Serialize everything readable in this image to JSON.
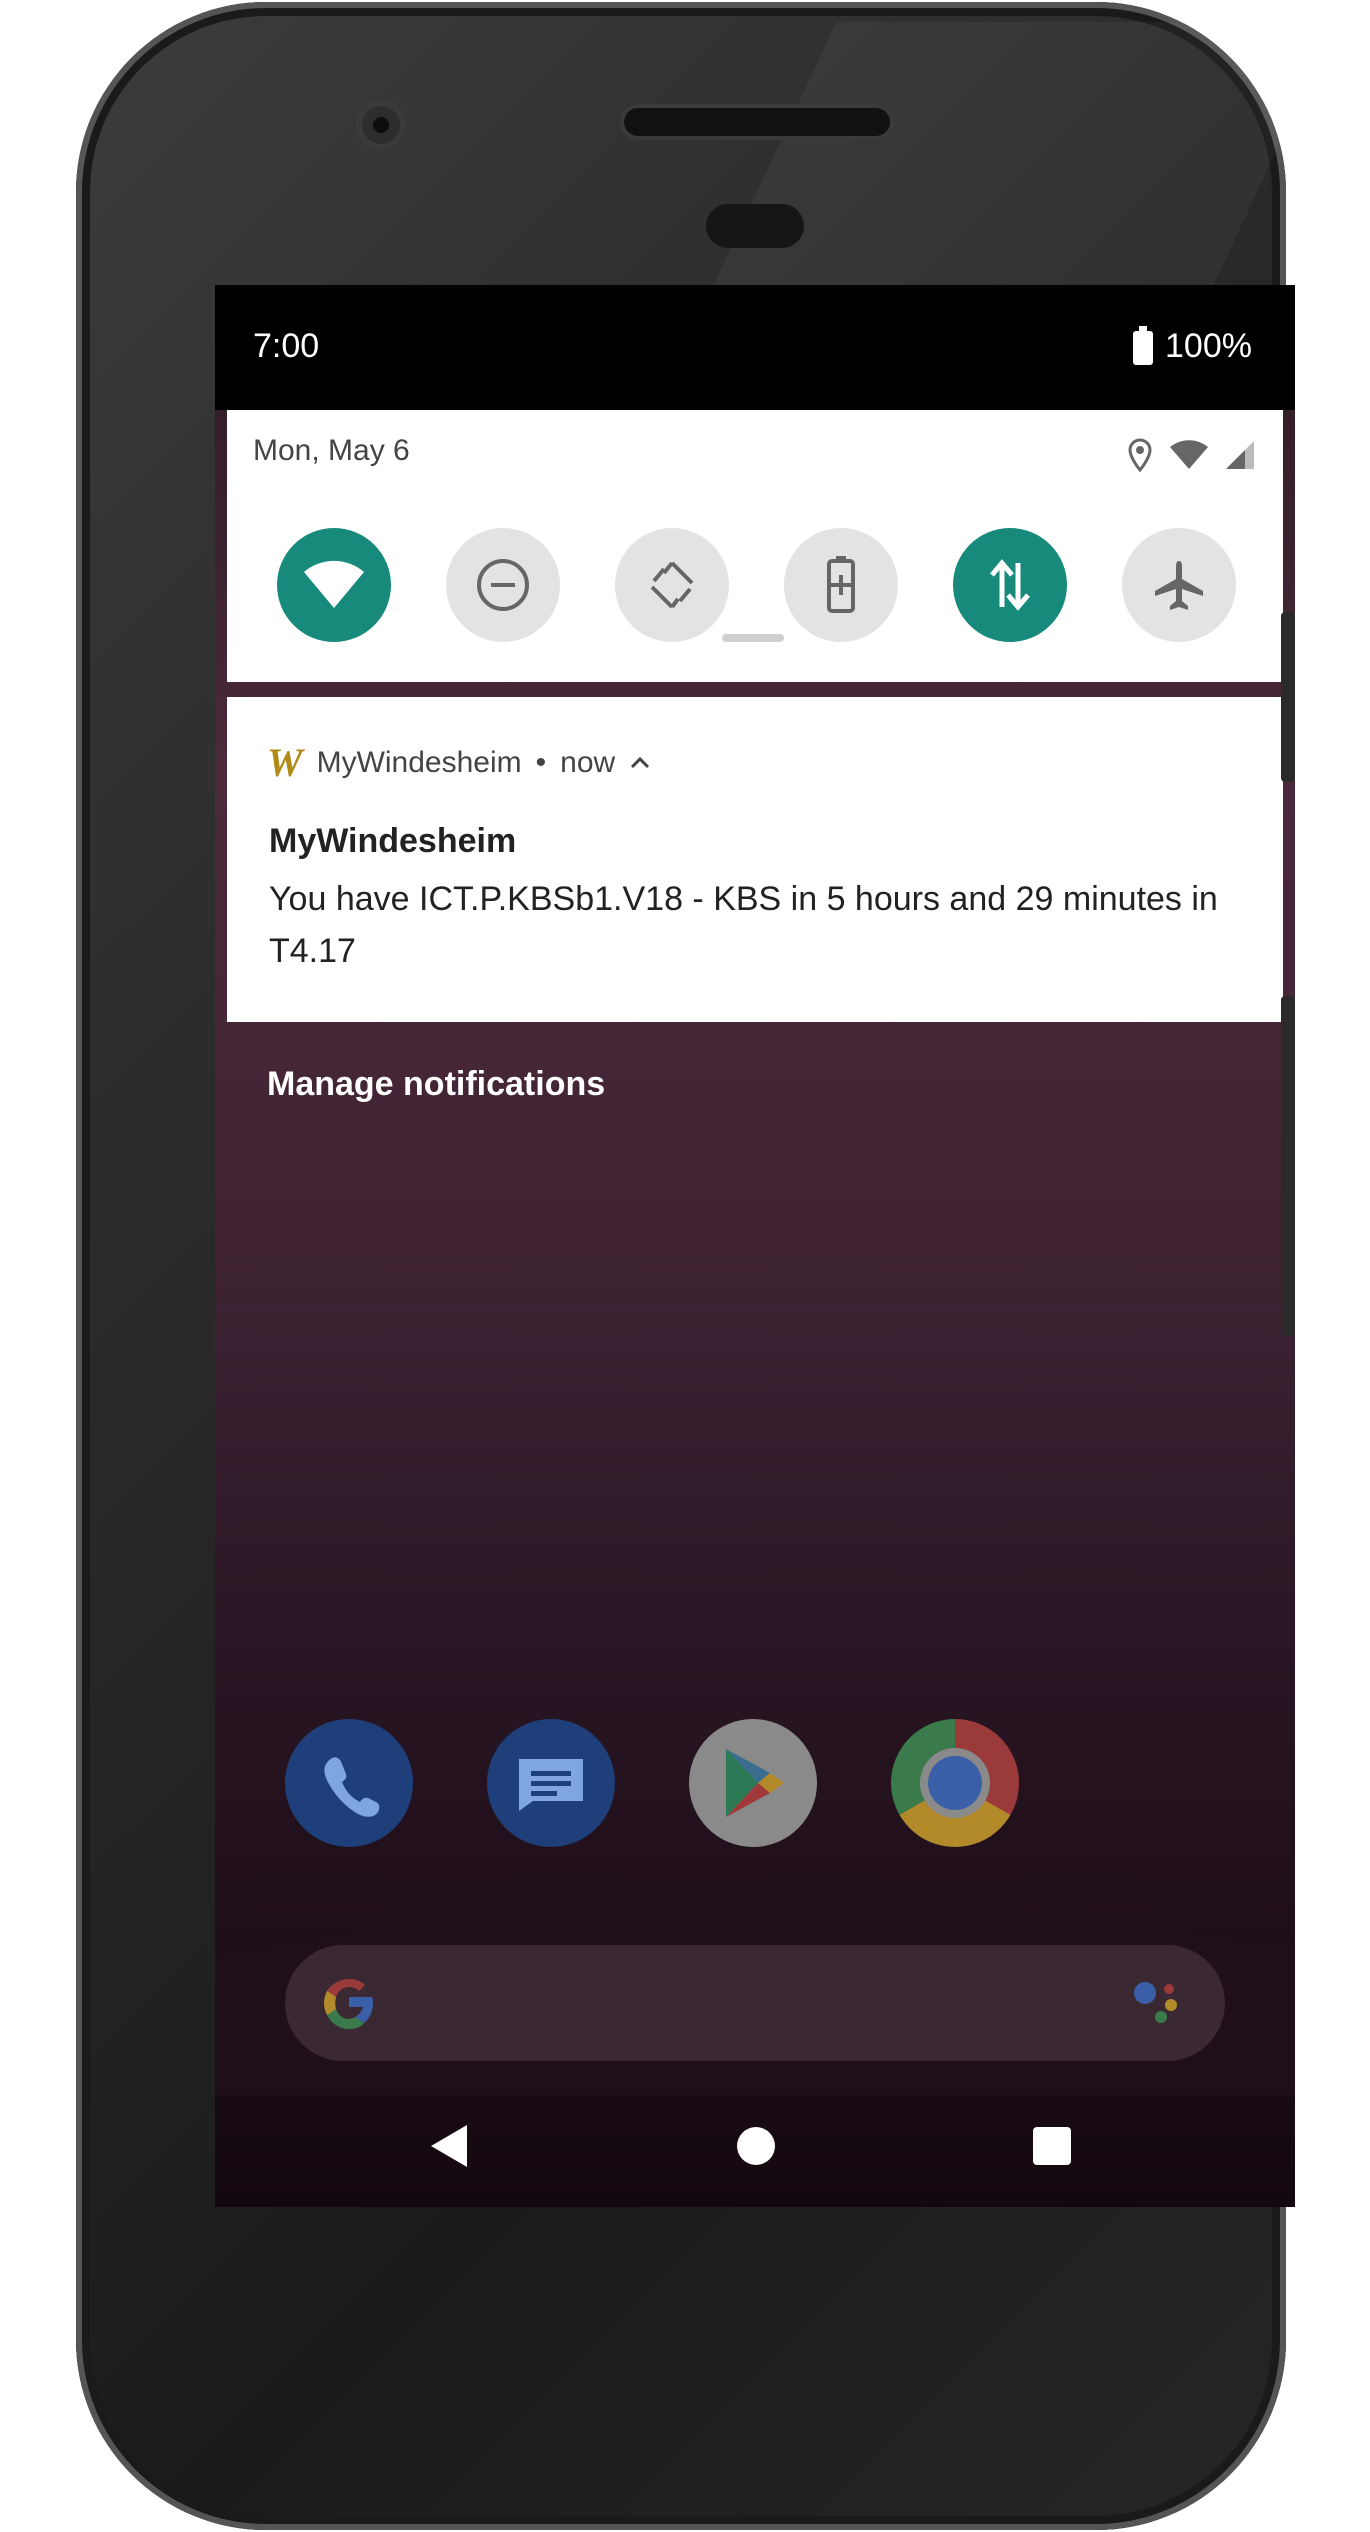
{
  "status_bar": {
    "time": "7:00",
    "battery": "100%"
  },
  "quick_settings": {
    "date": "Mon, May 6",
    "tiles": [
      {
        "name": "wifi",
        "state": "on"
      },
      {
        "name": "do-not-disturb",
        "state": "off"
      },
      {
        "name": "auto-rotate",
        "state": "off"
      },
      {
        "name": "battery-saver",
        "state": "off"
      },
      {
        "name": "mobile-data",
        "state": "on"
      },
      {
        "name": "airplane-mode",
        "state": "off"
      }
    ]
  },
  "notification": {
    "app_name": "MyWindesheim",
    "separator": "•",
    "when": "now",
    "title": "MyWindesheim",
    "text": "You have ICT.P.KBSb1.V18 - KBS in 5 hours and 29 minutes in T4.17"
  },
  "manage_label": "Manage notifications",
  "dock": {
    "apps": [
      "phone",
      "messages",
      "play-store",
      "chrome"
    ]
  },
  "colors": {
    "accent": "#178a7b",
    "app_logo": "#b08a18"
  }
}
